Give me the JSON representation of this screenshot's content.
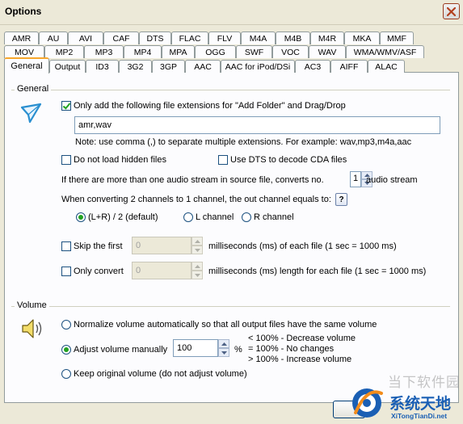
{
  "window": {
    "title": "Options"
  },
  "tabs": {
    "row1": [
      "AMR",
      "AU",
      "AVI",
      "CAF",
      "DTS",
      "FLAC",
      "FLV",
      "M4A",
      "M4B",
      "M4R",
      "MKA",
      "MMF"
    ],
    "row2": [
      "MOV",
      "MP2",
      "MP3",
      "MP4",
      "MPA",
      "OGG",
      "SWF",
      "VOC",
      "WAV",
      "WMA/WMV/ASF"
    ],
    "row3": [
      "General",
      "Output",
      "ID3",
      "3G2",
      "3GP",
      "AAC",
      "AAC for iPod/DSi",
      "AC3",
      "AIFF",
      "ALAC"
    ],
    "active": "General"
  },
  "general": {
    "group_label": "General",
    "only_add_label": "Only add the following file extensions for \"Add Folder\" and Drag/Drop",
    "only_add_checked": true,
    "extensions_value": "amr,wav",
    "note": "Note: use comma (,) to separate multiple extensions. For example: wav,mp3,m4a,aac",
    "no_hidden_label": "Do not load hidden files",
    "no_hidden_checked": false,
    "use_dts_label": "Use DTS to decode CDA files",
    "use_dts_checked": false,
    "multi_stream_label": "If there are more than one audio stream in source file, converts no.",
    "stream_no": "1",
    "stream_suffix": "audio stream",
    "channels_label": "When converting 2 channels to 1 channel, the out channel equals to:",
    "help_label": "?",
    "channel_options": [
      "(L+R) / 2 (default)",
      "L channel",
      "R channel"
    ],
    "channel_selected": 0,
    "skip_first_label": "Skip the first",
    "skip_first_value": "0",
    "skip_first_suffix": "milliseconds (ms) of each file (1 sec = 1000 ms)",
    "only_convert_label": "Only convert",
    "only_convert_value": "0",
    "only_convert_suffix": "milliseconds (ms) length for each file (1 sec = 1000 ms)"
  },
  "volume": {
    "group_label": "Volume",
    "normalize_label": "Normalize volume automatically so that all output files have the same volume",
    "adjust_label": "Adjust volume manually",
    "adjust_value": "100",
    "percent": "%",
    "hints": [
      "< 100% - Decrease volume",
      "= 100% - No changes",
      "> 100% - Increase volume"
    ],
    "keep_label": "Keep original volume (do not adjust volume)",
    "selected": 1
  },
  "watermark": {
    "cn": "当下软件园",
    "brand": "系统天地",
    "url": "XiTongTianDi.net"
  },
  "colors": {
    "accent_tab": "#f7a62b",
    "check": "#21a121",
    "brand": "#1a5fb4"
  },
  "icons": {
    "general": "cursor-arrow-icon",
    "volume": "speaker-icon",
    "close": "close-icon"
  }
}
